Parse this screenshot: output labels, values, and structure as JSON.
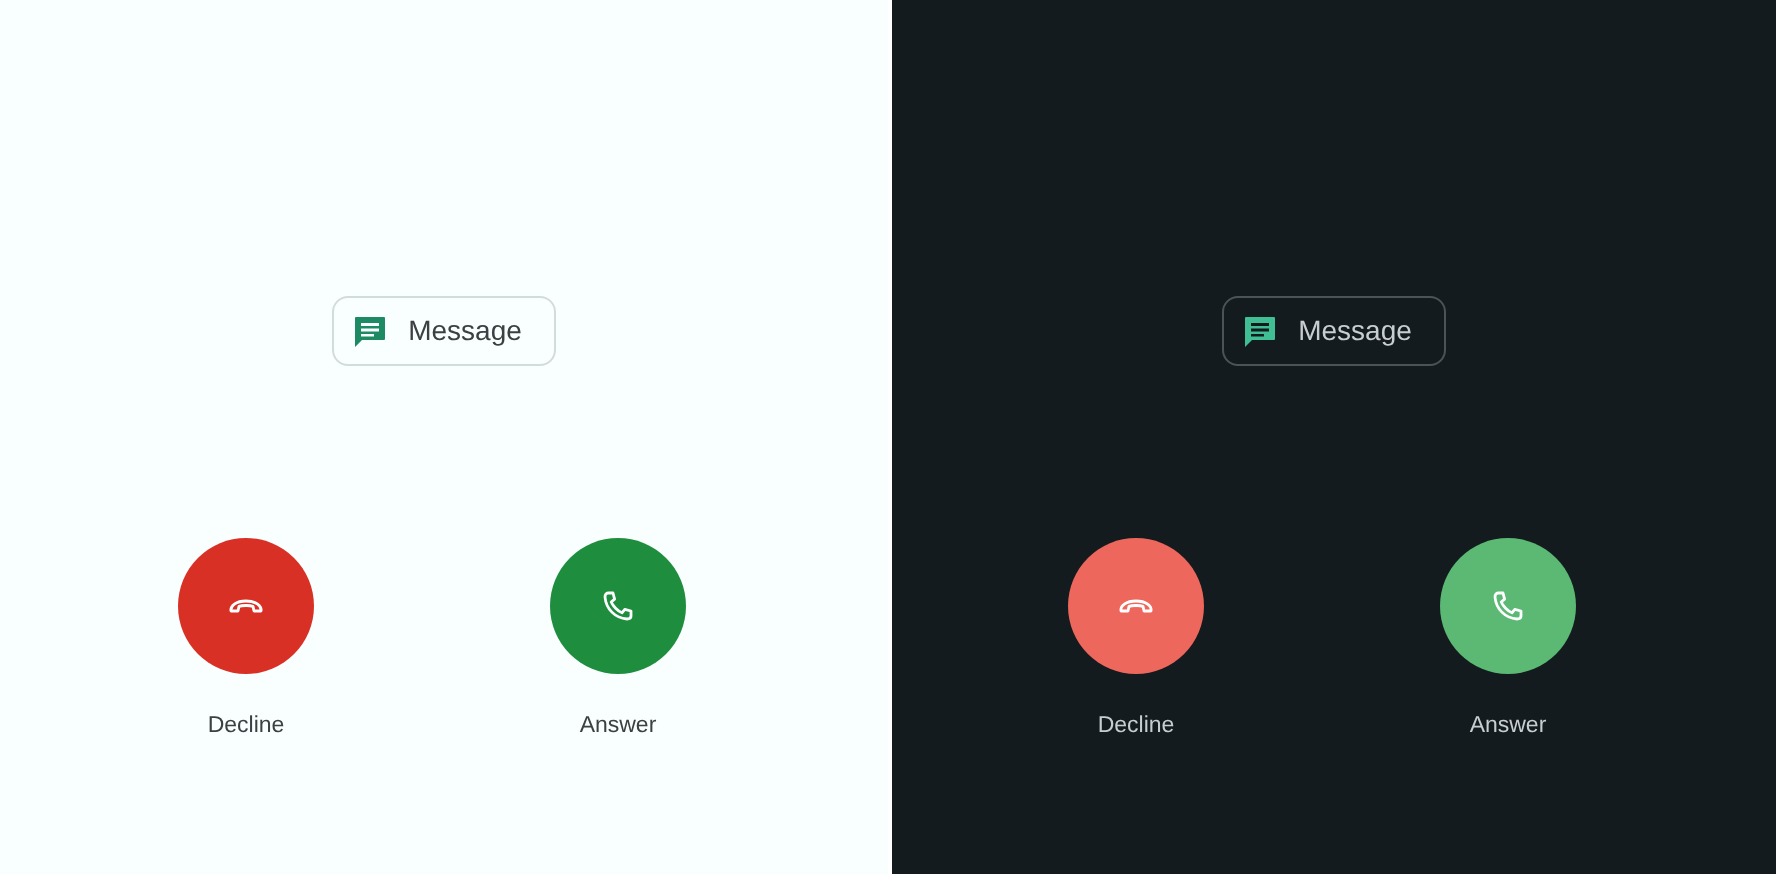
{
  "panels": [
    {
      "dark": false,
      "message_button": {
        "label": "Message"
      },
      "actions": [
        {
          "kind": "decline",
          "label": "Decline"
        },
        {
          "kind": "answer",
          "label": "Answer"
        }
      ]
    },
    {
      "dark": true,
      "message_button": {
        "label": "Message"
      },
      "actions": [
        {
          "kind": "decline",
          "label": "Decline"
        },
        {
          "kind": "answer",
          "label": "Answer"
        }
      ]
    }
  ]
}
